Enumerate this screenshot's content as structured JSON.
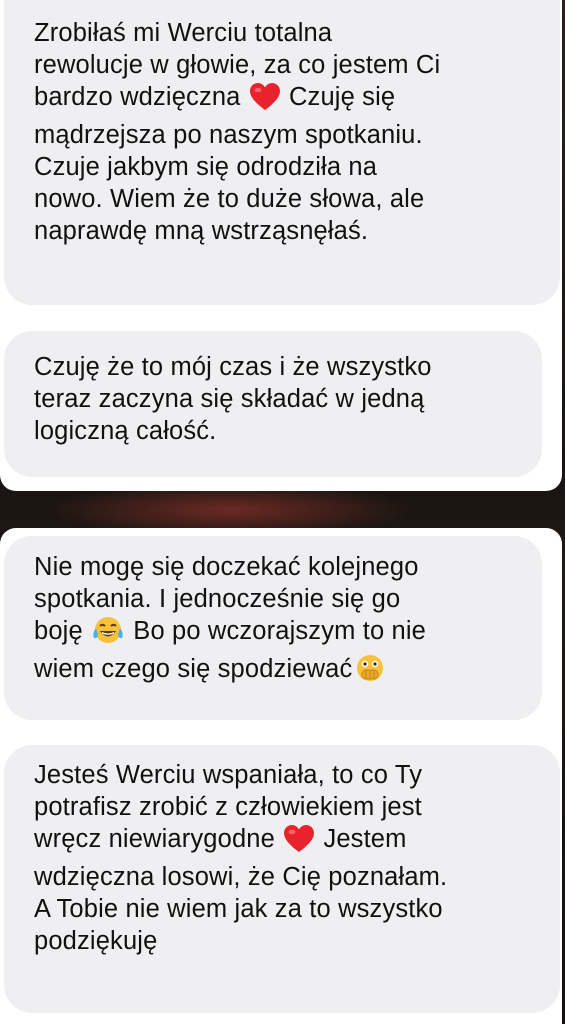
{
  "messages": [
    {
      "lines": [
        "Zrobiłaś mi Werciu totalna",
        "rewolucje w głowie, za co jestem Ci",
        [
          "bardzo wdzięczna ",
          "heart",
          " Czuję się"
        ],
        "mądrzejsza po naszym spotkaniu.",
        "Czuje jakbym się odrodziła na",
        "nowo. Wiem że to duże słowa, ale",
        "naprawdę mną wstrząsnęłaś."
      ]
    },
    {
      "lines": [
        "Czuję że to mój czas i że wszystko",
        "teraz zaczyna się składać w jedną",
        "logiczną całość."
      ]
    },
    {
      "lines": [
        "Nie mogę się doczekać kolejnego",
        "spotkania. I jednocześnie się go",
        [
          "boję ",
          "tears-of-joy",
          " Bo po wczorajszym to nie"
        ],
        [
          "wiem czego się spodziewać",
          "shocked-face",
          ""
        ]
      ]
    },
    {
      "lines": [
        "Jesteś Werciu wspaniała, to co Ty",
        "potrafisz zrobić z człowiekiem jest",
        [
          "wręcz niewiarygodne ",
          "heart",
          " Jestem"
        ],
        "wdzięczna losowi, że Cię poznałam.",
        "A Tobie nie wiem jak za to wszystko",
        "podziękuję"
      ]
    }
  ],
  "icons": {
    "heart": "red-heart-emoji",
    "tears-of-joy": "face-with-tears-of-joy-emoji",
    "shocked-face": "face-with-open-eyes-and-hand-over-mouth-emoji"
  },
  "colors": {
    "bubble": "#efeff1",
    "card": "#ffffff",
    "text": "#111111",
    "heart": "#e8232b",
    "emoji_face": "#f7c23a"
  }
}
